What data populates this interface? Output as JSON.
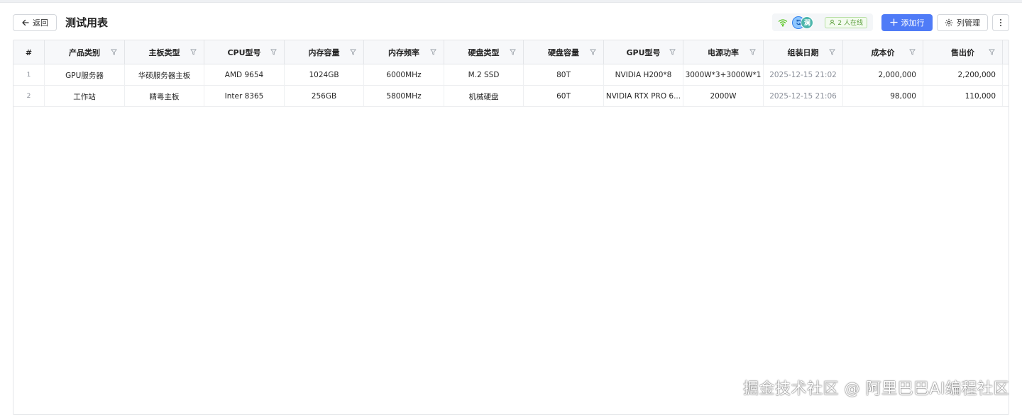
{
  "header": {
    "back_label": "返回",
    "title": "测试用表",
    "avatars": [
      "",
      "澜"
    ],
    "online_label": "2 人在线",
    "add_row_label": "添加行",
    "column_manage_label": "列管理"
  },
  "colors": {
    "primary": "#4f7bf7",
    "online_green": "#5a9e3a",
    "border": "#e3e5e8"
  },
  "table": {
    "index_header": "#",
    "columns": [
      "产品类别",
      "主板类型",
      "CPU型号",
      "内存容量",
      "内存频率",
      "硬盘类型",
      "硬盘容量",
      "GPU型号",
      "电源功率",
      "组装日期",
      "成本价",
      "售出价"
    ],
    "rows": [
      {
        "index": "1",
        "cells": [
          "GPU服务器",
          "华硕服务器主板",
          "AMD 9654",
          "1024GB",
          "6000MHz",
          "M.2 SSD",
          "80T",
          "NVIDIA H200*8",
          "3000W*3+3000W*1",
          "2025-12-15 21:02",
          "2,000,000",
          "2,200,000"
        ]
      },
      {
        "index": "2",
        "cells": [
          "工作站",
          "精粤主板",
          "Inter 8365",
          "256GB",
          "5800MHz",
          "机械硬盘",
          "60T",
          "NVIDIA RTX PRO 6...",
          "2000W",
          "2025-12-15 21:06",
          "98,000",
          "110,000"
        ]
      }
    ]
  },
  "watermark": "掘金技术社区 @ 阿里巴巴AI编程社区"
}
